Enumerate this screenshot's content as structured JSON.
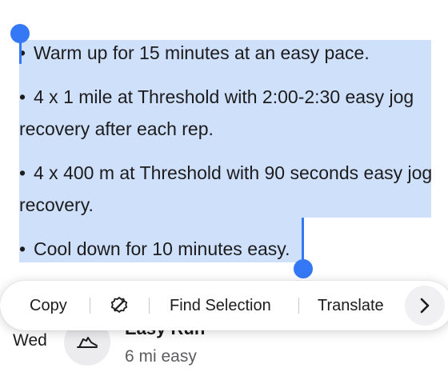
{
  "note": {
    "bullet": "•",
    "items": [
      "Warm up for 15 minutes at an easy pace.",
      "4 x 1 mile at Threshold with 2:00-2:30 easy jog recovery after each rep.",
      "4 x 400 m at Threshold with 90 seconds easy jog recovery.",
      "Cool down for 10 minutes easy."
    ]
  },
  "workout": {
    "day": "Wed",
    "title": "Easy Run",
    "subtitle": "6 mi easy",
    "icon": "running-shoe-icon"
  },
  "edit_menu": {
    "copy": "Copy",
    "writing_tools_icon": "writing-tools-icon",
    "find_selection": "Find Selection",
    "translate": "Translate",
    "more_icon": "chevron-right-icon"
  },
  "colors": {
    "selection": "#cfe0fa",
    "handle": "#3478f6"
  }
}
